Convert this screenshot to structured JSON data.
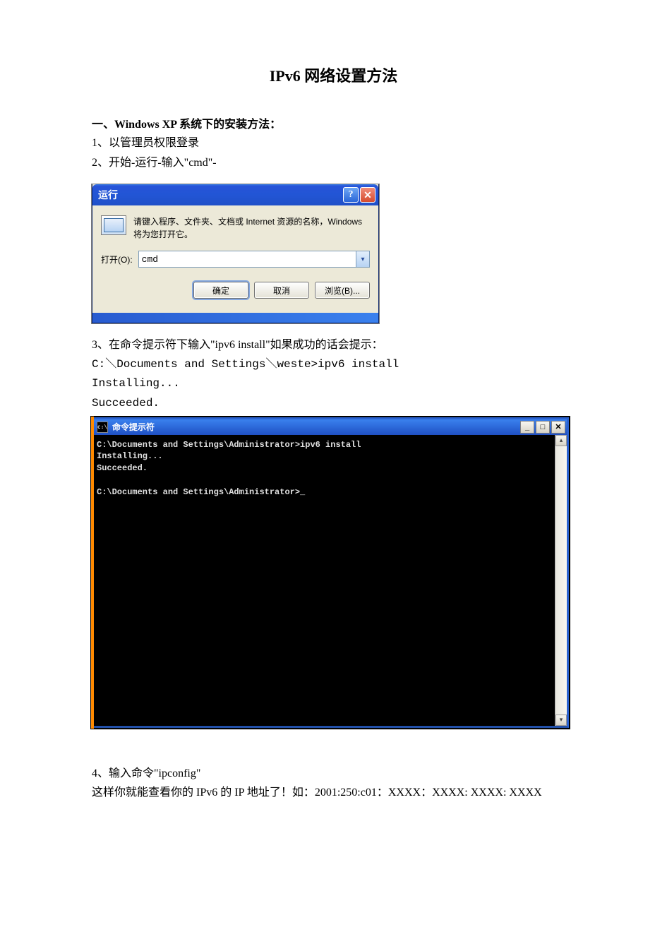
{
  "doc": {
    "title": "IPv6 网络设置方法",
    "section1_heading": "一、Windows XP 系统下的安装方法：",
    "step1": "1、以管理员权限登录",
    "step2": "2、开始-运行-输入\"cmd\"-",
    "step3": "3、在命令提示符下输入\"ipv6 install\"如果成功的话会提示：",
    "step3_out1": "C:＼Documents and Settings＼weste>ipv6 install",
    "step3_out2": "Installing...",
    "step3_out3": "Succeeded.",
    "step4_a": "4、输入命令\"ipconfig\"",
    "step4_b": "这样你就能查看你的 IPv6 的 IP 地址了！如：2001:250:c01：XXXX：XXXX: XXXX: XXXX"
  },
  "run_dialog": {
    "title": "运行",
    "help_glyph": "?",
    "close_glyph": "✕",
    "description": "请键入程序、文件夹、文档或 Internet 资源的名称，Windows 将为您打开它。",
    "open_label": "打开(O):",
    "input_value": "cmd",
    "dropdown_glyph": "▾",
    "ok": "确定",
    "cancel": "取消",
    "browse": "浏览(B)..."
  },
  "cmd_window": {
    "icon_text": "c:\\",
    "title": "命令提示符",
    "min_glyph": "_",
    "max_glyph": "□",
    "close_glyph": "✕",
    "scroll_up": "▴",
    "scroll_down": "▾",
    "lines": [
      "C:\\Documents and Settings\\Administrator>ipv6 install",
      "Installing...",
      "Succeeded.",
      "",
      "C:\\Documents and Settings\\Administrator>_"
    ]
  }
}
